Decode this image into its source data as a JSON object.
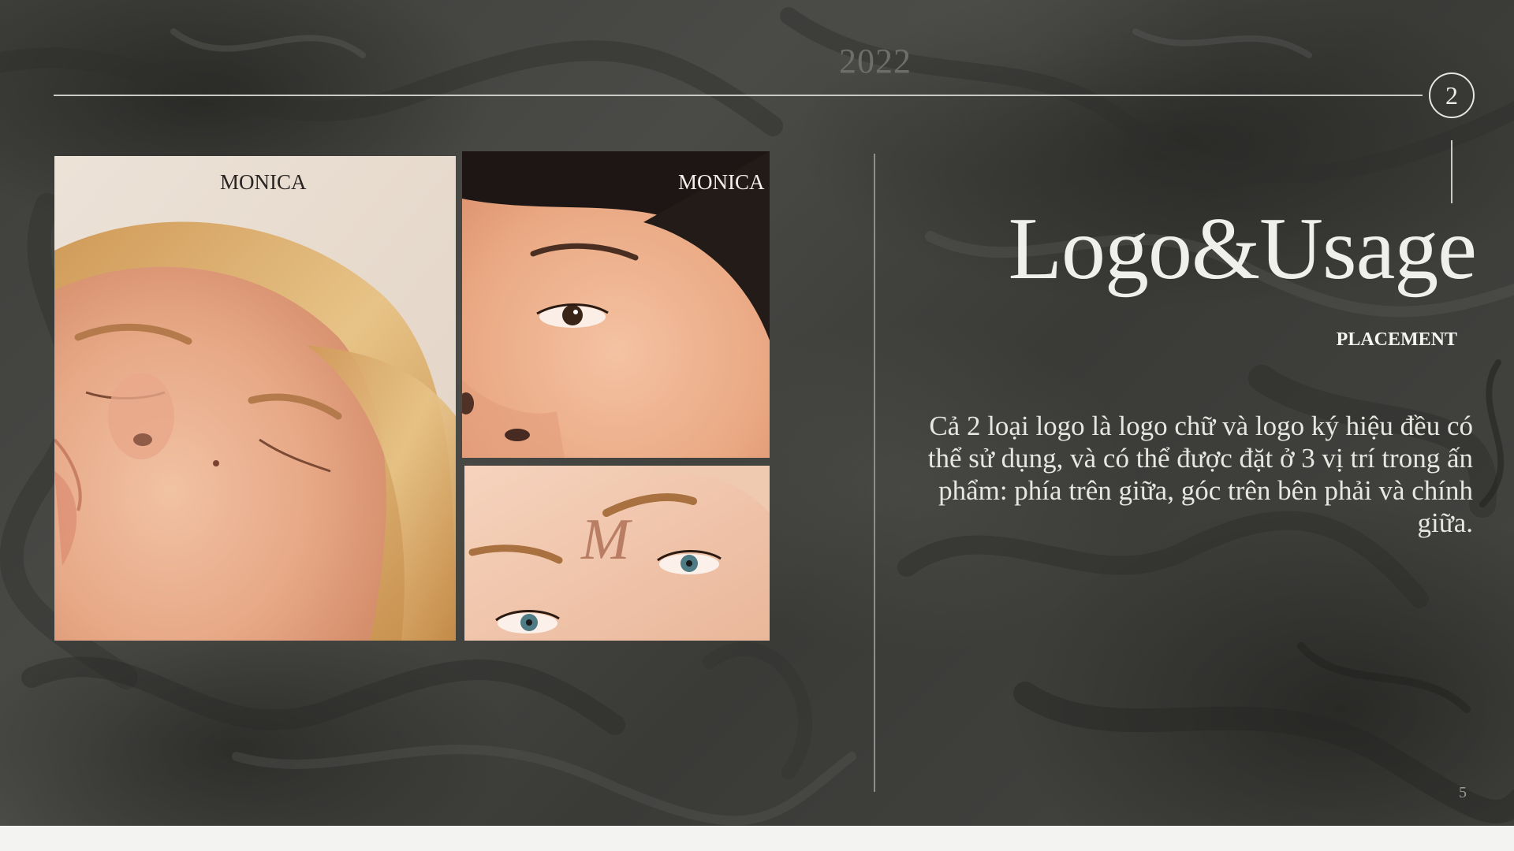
{
  "slide": {
    "year": "2022",
    "section_number": "2",
    "title": "Logo&Usage",
    "subtitle": "PLACEMENT",
    "body": "Cả 2 loại logo là logo chữ và logo ký hiệu đều có thể sử dụng, và có thể được đặt ở 3 vị trí trong ấn phẩm: phía trên giữa, góc trên bên phải và chính giữa.",
    "page_number": "5"
  },
  "photos": [
    {
      "logo_text": "MONICA",
      "logo_color": "#2a2522"
    },
    {
      "logo_text": "MONICA",
      "logo_color": "#f3efe9"
    },
    {
      "logo_text": "M",
      "logo_color": "#9a5037"
    }
  ]
}
